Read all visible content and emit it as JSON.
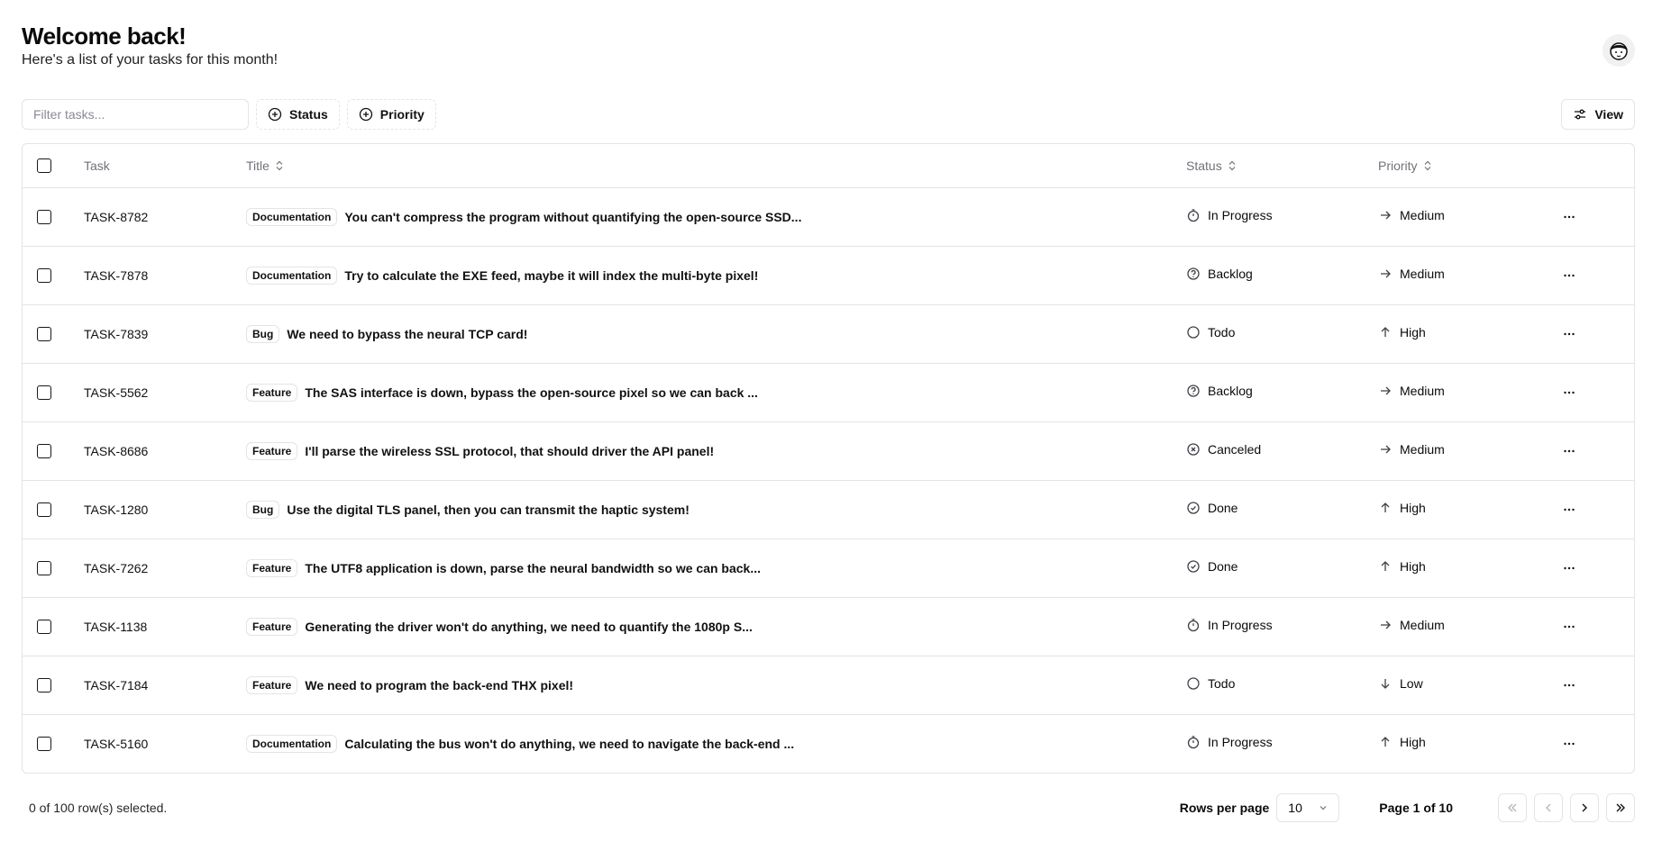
{
  "header": {
    "title": "Welcome back!",
    "subtitle": "Here's a list of your tasks for this month!"
  },
  "toolbar": {
    "filter_placeholder": "Filter tasks...",
    "filter_value": "",
    "status_label": "Status",
    "priority_label": "Priority",
    "view_label": "View"
  },
  "table": {
    "headers": {
      "task": "Task",
      "title": "Title",
      "status": "Status",
      "priority": "Priority"
    },
    "rows": [
      {
        "id": "TASK-8782",
        "label": "Documentation",
        "title": "You can't compress the program without quantifying the open-source SSD...",
        "status": "In Progress",
        "status_icon": "timer-icon",
        "priority": "Medium",
        "priority_icon": "arrow-right-icon"
      },
      {
        "id": "TASK-7878",
        "label": "Documentation",
        "title": "Try to calculate the EXE feed, maybe it will index the multi-byte pixel!",
        "status": "Backlog",
        "status_icon": "help-circle-icon",
        "priority": "Medium",
        "priority_icon": "arrow-right-icon"
      },
      {
        "id": "TASK-7839",
        "label": "Bug",
        "title": "We need to bypass the neural TCP card!",
        "status": "Todo",
        "status_icon": "circle-icon",
        "priority": "High",
        "priority_icon": "arrow-up-icon"
      },
      {
        "id": "TASK-5562",
        "label": "Feature",
        "title": "The SAS interface is down, bypass the open-source pixel so we can back ...",
        "status": "Backlog",
        "status_icon": "help-circle-icon",
        "priority": "Medium",
        "priority_icon": "arrow-right-icon"
      },
      {
        "id": "TASK-8686",
        "label": "Feature",
        "title": "I'll parse the wireless SSL protocol, that should driver the API panel!",
        "status": "Canceled",
        "status_icon": "x-circle-icon",
        "priority": "Medium",
        "priority_icon": "arrow-right-icon"
      },
      {
        "id": "TASK-1280",
        "label": "Bug",
        "title": "Use the digital TLS panel, then you can transmit the haptic system!",
        "status": "Done",
        "status_icon": "check-circle-icon",
        "priority": "High",
        "priority_icon": "arrow-up-icon"
      },
      {
        "id": "TASK-7262",
        "label": "Feature",
        "title": "The UTF8 application is down, parse the neural bandwidth so we can back...",
        "status": "Done",
        "status_icon": "check-circle-icon",
        "priority": "High",
        "priority_icon": "arrow-up-icon"
      },
      {
        "id": "TASK-1138",
        "label": "Feature",
        "title": "Generating the driver won't do anything, we need to quantify the 1080p S...",
        "status": "In Progress",
        "status_icon": "timer-icon",
        "priority": "Medium",
        "priority_icon": "arrow-right-icon"
      },
      {
        "id": "TASK-7184",
        "label": "Feature",
        "title": "We need to program the back-end THX pixel!",
        "status": "Todo",
        "status_icon": "circle-icon",
        "priority": "Low",
        "priority_icon": "arrow-down-icon"
      },
      {
        "id": "TASK-5160",
        "label": "Documentation",
        "title": "Calculating the bus won't do anything, we need to navigate the back-end ...",
        "status": "In Progress",
        "status_icon": "timer-icon",
        "priority": "High",
        "priority_icon": "arrow-up-icon"
      }
    ]
  },
  "footer": {
    "selected_text": "0 of 100 row(s) selected.",
    "rows_per_page_label": "Rows per page",
    "rows_per_page_value": "10",
    "page_text": "Page 1 of 10"
  }
}
